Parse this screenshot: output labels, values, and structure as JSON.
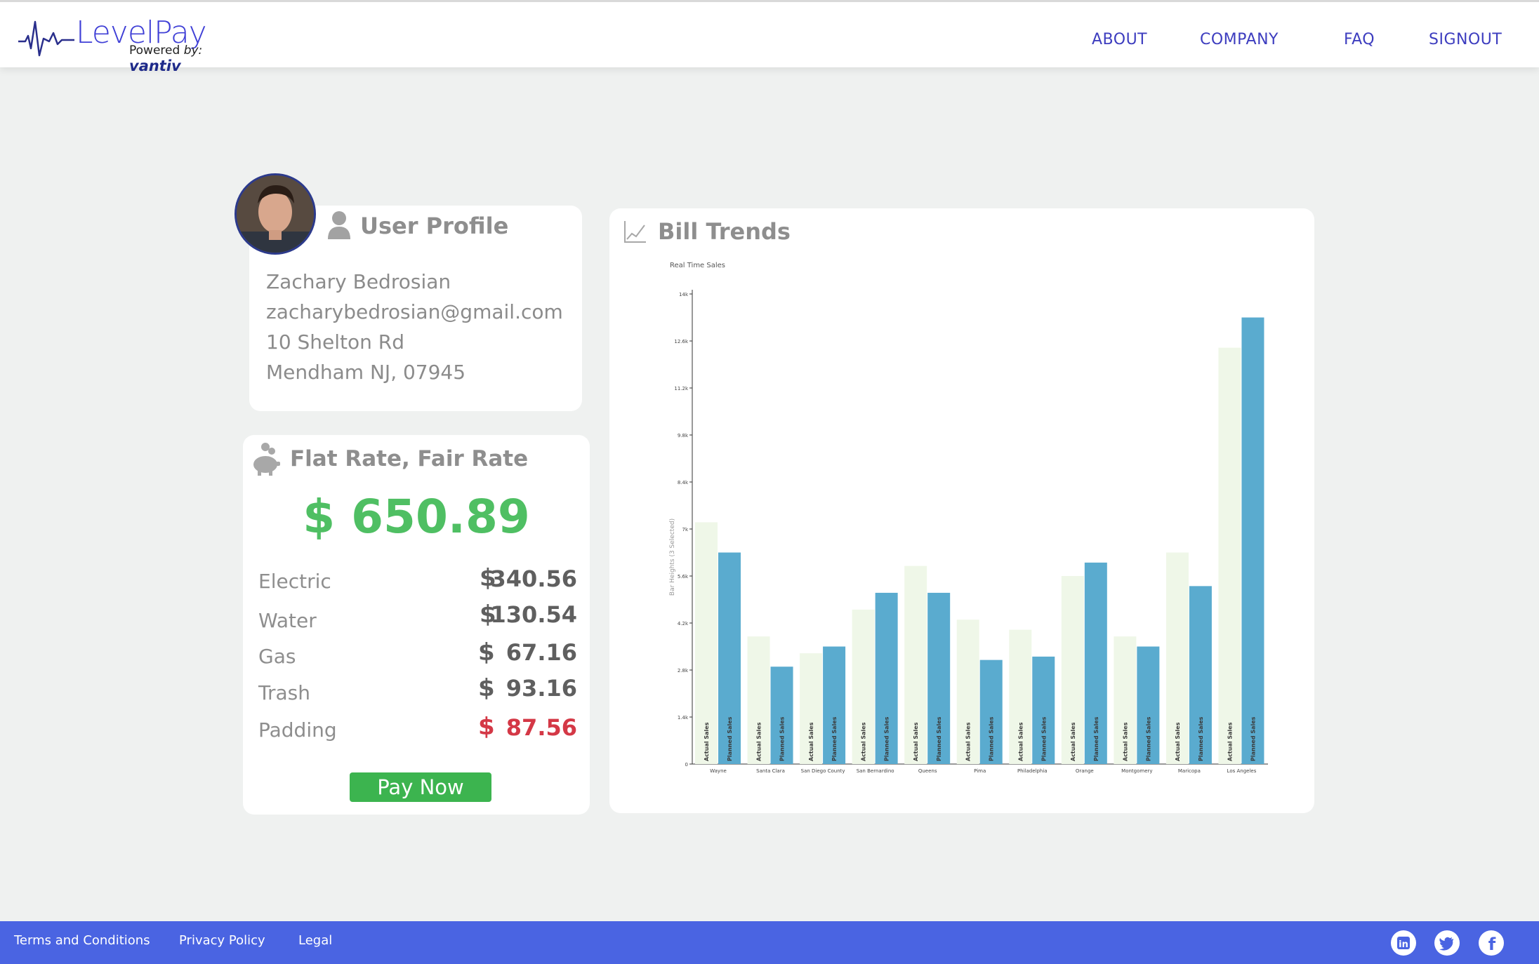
{
  "header": {
    "logo": {
      "wordmark": "LevelPay",
      "powered": "Powered",
      "by": "by:",
      "brand": "vantiv"
    },
    "nav": [
      {
        "label": "ABOUT"
      },
      {
        "label": "COMPANY"
      },
      {
        "label": "FAQ"
      },
      {
        "label": "SIGNOUT"
      }
    ]
  },
  "profile": {
    "title": "User Profile",
    "name": "Zachary Bedrosian",
    "email": "zacharybedrosian@gmail.com",
    "address1": "10 Shelton Rd",
    "address2": "Mendham NJ, 07945"
  },
  "rate": {
    "title": "Flat Rate, Fair Rate",
    "total": "$ 650.89",
    "currency": "$",
    "bills": [
      {
        "label": "Electric",
        "amount": "340.56"
      },
      {
        "label": "Water",
        "amount": "130.54"
      },
      {
        "label": "Gas",
        "amount": "67.16"
      },
      {
        "label": "Trash",
        "amount": "93.16"
      },
      {
        "label": "Padding",
        "amount": "87.56"
      }
    ],
    "pay_label": "Pay Now"
  },
  "trends": {
    "title": "Bill Trends"
  },
  "chart_data": {
    "type": "bar",
    "title": "Real Time Sales",
    "xlabel": "",
    "ylabel": "Bar Heights (3 Selected)",
    "ylim": [
      0,
      14
    ],
    "ytick_labels": [
      "0",
      "1.4k",
      "2.8k",
      "4.2k",
      "5.6k",
      "7k",
      "8.4k",
      "9.8k",
      "11.2k",
      "12.6k",
      "14k"
    ],
    "categories": [
      "Wayne",
      "Santa Clara",
      "San Diego County",
      "San Bernardino",
      "Queens",
      "Pima",
      "Philadelphia",
      "Orange",
      "Montgomery",
      "Maricopa",
      "Los Angeles"
    ],
    "series": [
      {
        "name": "Actual Sales",
        "bar_label": "Actual Sales",
        "color": "#eff7e8",
        "values": [
          7.2,
          3.8,
          3.3,
          4.6,
          5.9,
          4.3,
          4.0,
          5.6,
          3.8,
          6.3,
          12.4
        ]
      },
      {
        "name": "Planned Sales",
        "bar_label": "Planned Sales",
        "color": "#5aabcf",
        "values": [
          6.3,
          2.9,
          3.5,
          5.1,
          5.1,
          3.1,
          3.2,
          6.0,
          3.5,
          5.3,
          13.3
        ]
      }
    ],
    "legend": "none",
    "grid": false
  },
  "footer": {
    "links": [
      {
        "label": "Terms and Conditions"
      },
      {
        "label": "Privacy Policy"
      },
      {
        "label": "Legal"
      }
    ],
    "social": [
      {
        "icon": "linkedin-icon",
        "glyph": "in"
      },
      {
        "icon": "twitter-icon"
      },
      {
        "icon": "facebook-icon",
        "glyph": "f"
      }
    ]
  },
  "colors": {
    "brand": "#3f3fd6",
    "footer": "#4a64e2",
    "total_green": "#4fbf63",
    "button_green": "#3cb44f",
    "warning_red": "#d43846"
  }
}
